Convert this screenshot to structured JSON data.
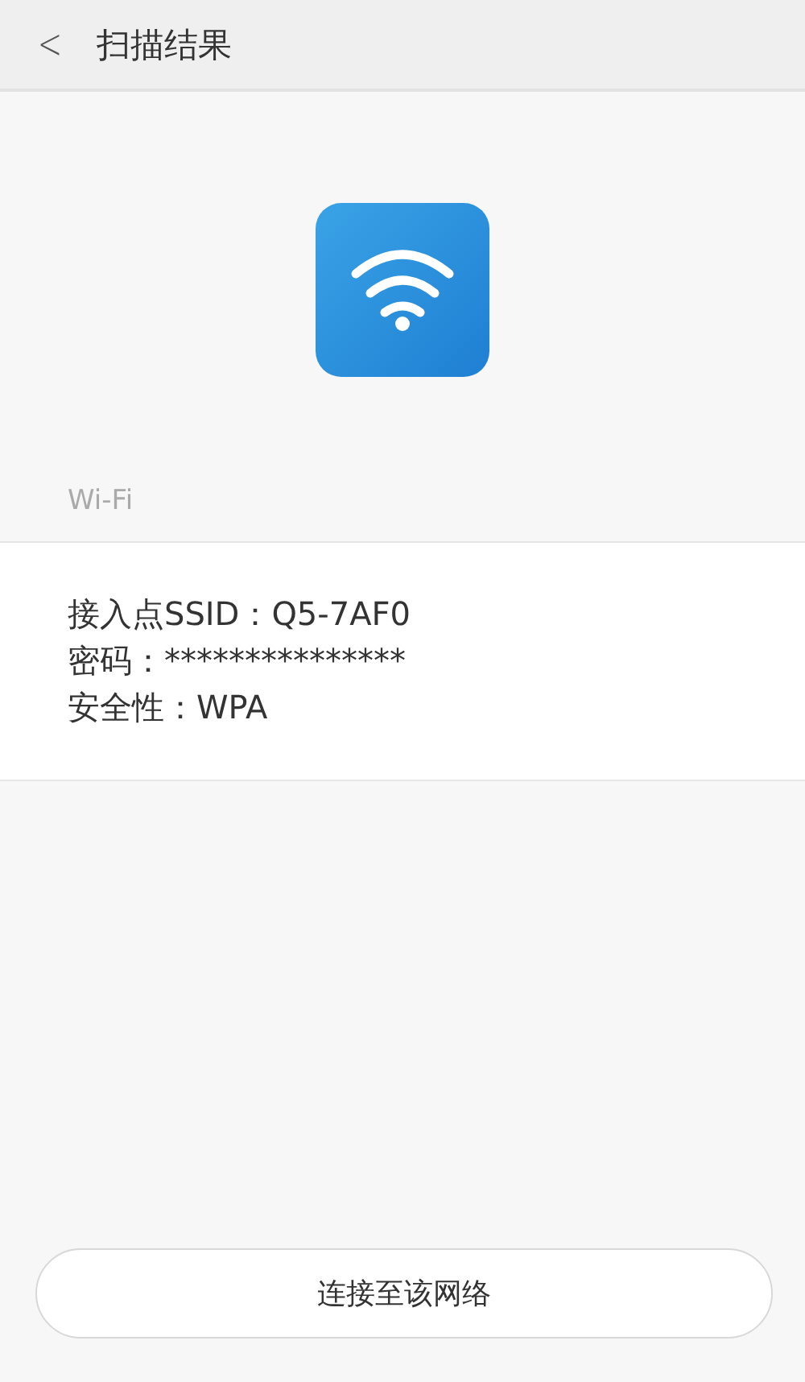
{
  "header": {
    "back": "<",
    "title": "扫描结果"
  },
  "section_label": "Wi-Fi",
  "details": [
    "接入点SSID：Q5-7AF0",
    "密码：***************",
    "安全性：WPA"
  ],
  "button": "连接至该网络"
}
